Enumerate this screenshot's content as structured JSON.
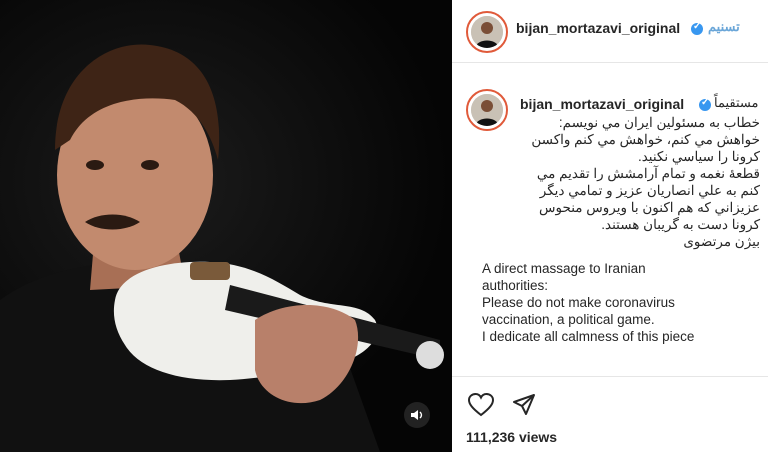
{
  "header": {
    "username": "bijan_mortazavi_original",
    "watermark": "تسنیم"
  },
  "post": {
    "username": "bijan_mortazavi_original",
    "live_label": "مستقیماً",
    "caption_fa": [
      "خطاب به مسئولین ایران مي نویسم:",
      "خواهش مي کنم، خواهش مي کنم واکسن",
      "کرونا را سیاسي نکنید.",
      "قطعهٔ نغمه و تمام آرامشش را تقدیم مي",
      "کنم به علي انصاریان عزیز و تمامي دیگر",
      "عزیزاني که هم اکنون با ویروس منحوس",
      "کرونا دست به گریبان هستند.",
      "بیژن مرتضوی"
    ],
    "caption_en": [
      "A direct massage to Iranian",
      "authorities:",
      "Please do not make coronavirus",
      "vaccination, a political game.",
      "I dedicate all calmness of this piece"
    ],
    "views": "111,236 views"
  },
  "icons": {
    "like": "heart-icon",
    "share": "paper-plane-icon",
    "sound": "speaker-icon"
  },
  "colors": {
    "verified": "#3897f0",
    "story_ring": "#e05a3a"
  }
}
